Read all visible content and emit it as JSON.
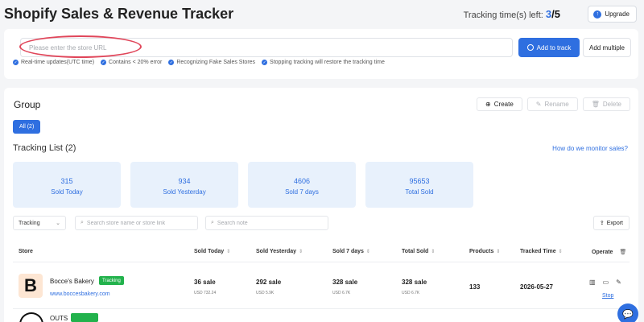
{
  "header": {
    "title": "Shopify Sales & Revenue Tracker",
    "tracking_left_label": "Tracking time(s) left:",
    "tracking_used": "3",
    "tracking_total": "/5",
    "upgrade_label": "Upgrade"
  },
  "track_form": {
    "url_placeholder": "Please enter the store URL",
    "add_button": "Add to track",
    "add_multiple_button": "Add multiple",
    "features": [
      "Real-time updates(UTC time)",
      "Contains < 20% error",
      "Recognizing Fake Sales Stores",
      "Stopping tracking will restore the tracking time"
    ]
  },
  "group": {
    "title": "Group",
    "create": "Create",
    "rename": "Rename",
    "delete": "Delete",
    "all_tab": "All (2)"
  },
  "tracking_list": {
    "title": "Tracking List (2)",
    "help_link": "How do we monitor sales?"
  },
  "stats": [
    {
      "value": "315",
      "label": "Sold Today"
    },
    {
      "value": "934",
      "label": "Sold Yesterday"
    },
    {
      "value": "4606",
      "label": "Sold 7 days"
    },
    {
      "value": "95653",
      "label": "Total Sold"
    }
  ],
  "filters": {
    "status_select": "Tracking",
    "store_search_placeholder": "Search store name or store link",
    "note_search_placeholder": "Search note",
    "export": "Export"
  },
  "table": {
    "columns": [
      "Store",
      "Sold Today",
      "Sold Yesterday",
      "Sold 7 days",
      "Total Sold",
      "Products",
      "Tracked Time",
      "Operate"
    ],
    "rows": [
      {
        "logo_letter": "B",
        "name": "Bocce's Bakery",
        "status": "Tracking",
        "url": "www.boccesbakery.com",
        "sold_today": "36 sale",
        "sold_today_usd": "USD 732.24",
        "sold_yesterday": "292 sale",
        "sold_yesterday_usd": "USD 5.9K",
        "sold_7days": "328 sale",
        "sold_7days_usd": "USD 6.7K",
        "total_sold": "328 sale",
        "total_sold_usd": "USD 6.7K",
        "products": "133",
        "tracked_time": "2026-05-27",
        "stop": "Stop"
      },
      {
        "name": "OUTS"
      }
    ]
  },
  "colors": {
    "accent": "#2f6fe0",
    "tracking_badge": "#22b24c",
    "annotation": "#e0465a"
  }
}
